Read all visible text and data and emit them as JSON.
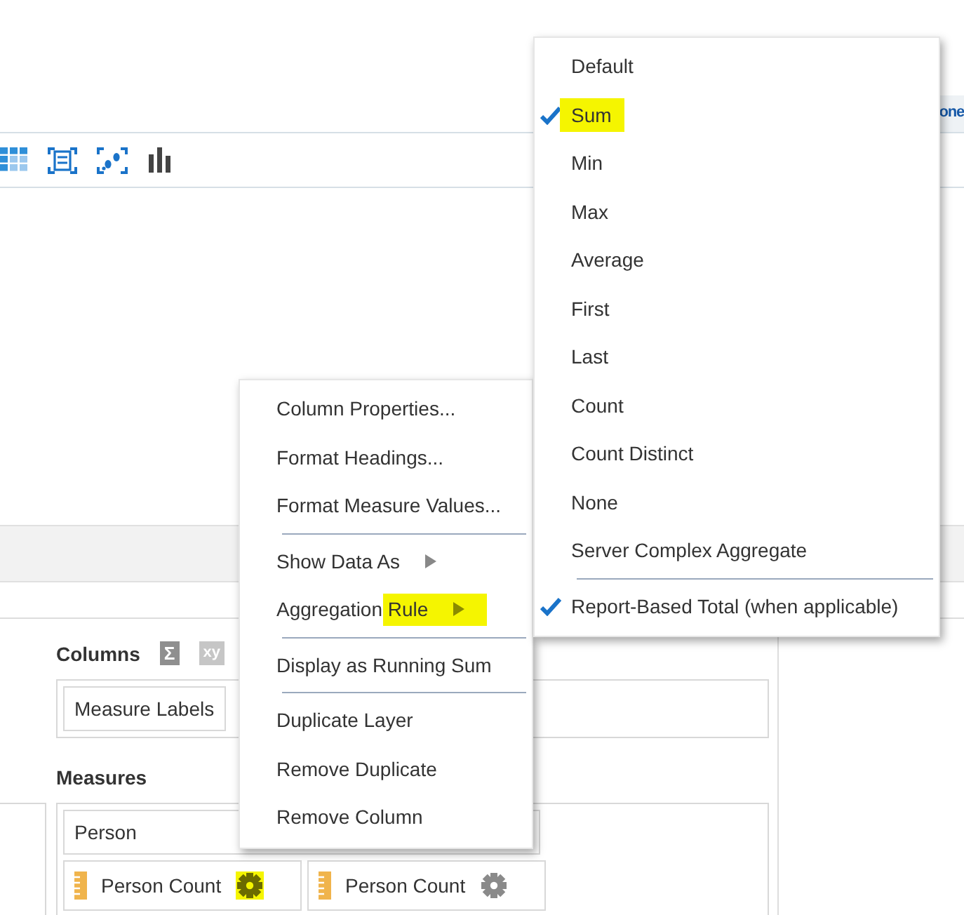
{
  "top_tab": {
    "label": "one"
  },
  "layout": {
    "columns": {
      "title": "Columns",
      "sum_button": "Σ",
      "xy_button": "xy",
      "items": [
        "Measure Labels"
      ]
    },
    "measures": {
      "title": "Measures",
      "header": "Person",
      "items": [
        {
          "label": "Person Count",
          "highlighted": true
        },
        {
          "label": "Person Count",
          "highlighted": false
        }
      ]
    }
  },
  "context_menu": {
    "items": [
      {
        "kind": "item",
        "label": "Column Properties..."
      },
      {
        "kind": "item",
        "label": "Format Headings..."
      },
      {
        "kind": "item",
        "label": "Format Measure Values..."
      },
      {
        "kind": "separator"
      },
      {
        "kind": "submenu",
        "label": "Show Data As",
        "highlighted": false
      },
      {
        "kind": "submenu",
        "label": "Aggregation Rule",
        "highlighted": true
      },
      {
        "kind": "separator"
      },
      {
        "kind": "item",
        "label": "Display as Running Sum"
      },
      {
        "kind": "separator"
      },
      {
        "kind": "item",
        "label": "Duplicate Layer"
      },
      {
        "kind": "item",
        "label": "Remove Duplicate"
      },
      {
        "kind": "item",
        "label": "Remove Column"
      }
    ]
  },
  "aggregation_menu": {
    "items": [
      {
        "kind": "option",
        "label": "Default",
        "checked": false,
        "highlighted": false
      },
      {
        "kind": "option",
        "label": "Sum",
        "checked": true,
        "highlighted": true
      },
      {
        "kind": "option",
        "label": "Min",
        "checked": false,
        "highlighted": false
      },
      {
        "kind": "option",
        "label": "Max",
        "checked": false,
        "highlighted": false
      },
      {
        "kind": "option",
        "label": "Average",
        "checked": false,
        "highlighted": false
      },
      {
        "kind": "option",
        "label": "First",
        "checked": false,
        "highlighted": false
      },
      {
        "kind": "option",
        "label": "Last",
        "checked": false,
        "highlighted": false
      },
      {
        "kind": "option",
        "label": "Count",
        "checked": false,
        "highlighted": false
      },
      {
        "kind": "option",
        "label": "Count Distinct",
        "checked": false,
        "highlighted": false
      },
      {
        "kind": "option",
        "label": "None",
        "checked": false,
        "highlighted": false
      },
      {
        "kind": "option",
        "label": "Server Complex Aggregate",
        "checked": false,
        "highlighted": false
      },
      {
        "kind": "separator"
      },
      {
        "kind": "option",
        "label": "Report-Based Total (when applicable)",
        "checked": true,
        "highlighted": false
      }
    ]
  }
}
